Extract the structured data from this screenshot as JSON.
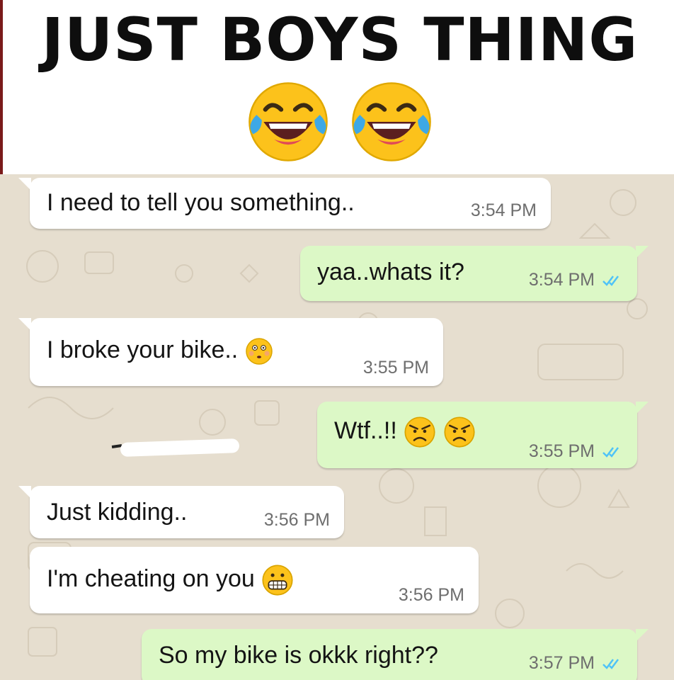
{
  "header": {
    "title": "JUST BOYS THING",
    "emojis": [
      "tears-of-joy-icon",
      "tears-of-joy-icon"
    ]
  },
  "chat": {
    "background_color": "#e6decf",
    "incoming_color": "#ffffff",
    "outgoing_color": "#dcf8c6",
    "tick_color": "#4fc3f7",
    "messages": [
      {
        "direction": "in",
        "text": "I need to tell you something..",
        "time": "3:54 PM",
        "emojis": []
      },
      {
        "direction": "out",
        "text": "yaa..whats it?",
        "time": "3:54 PM",
        "read": true,
        "emojis": []
      },
      {
        "direction": "in",
        "text": "I broke your bike..",
        "time": "3:55 PM",
        "emojis": [
          "flushed-face-icon"
        ]
      },
      {
        "direction": "out",
        "text": "Wtf..!!",
        "time": "3:55 PM",
        "read": true,
        "emojis": [
          "angry-face-icon",
          "angry-face-icon"
        ]
      },
      {
        "direction": "in",
        "text": "Just kidding..",
        "time": "3:56 PM",
        "emojis": []
      },
      {
        "direction": "in",
        "text": "I'm cheating on you",
        "time": "3:56 PM",
        "emojis": [
          "grimacing-face-icon"
        ]
      },
      {
        "direction": "out",
        "text": "So my bike is okkk right??",
        "time": "3:57 PM",
        "read": true,
        "emojis": []
      }
    ]
  }
}
